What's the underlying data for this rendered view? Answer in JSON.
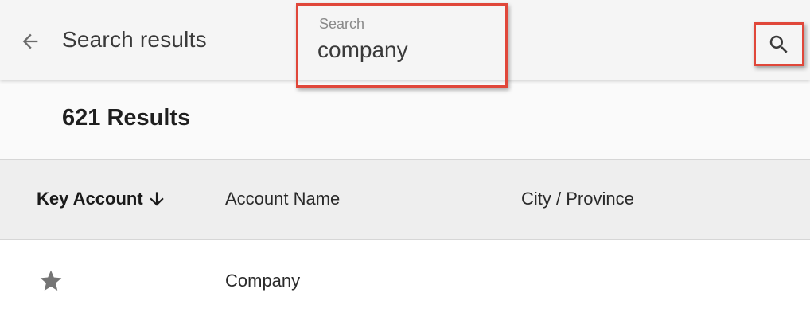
{
  "header": {
    "back_icon": "arrow-left-icon",
    "title": "Search results"
  },
  "search": {
    "label": "Search",
    "value": "company",
    "button_icon": "search-icon"
  },
  "results": {
    "count_label": "621 Results"
  },
  "table": {
    "columns": [
      {
        "label": "Key Account",
        "sorted": true,
        "sort_icon": "arrow-down-icon"
      },
      {
        "label": "Account Name"
      },
      {
        "label": "City / Province"
      }
    ],
    "rows": [
      {
        "key_account_icon": "star-icon",
        "account_name": "Company",
        "city_province": ""
      }
    ]
  },
  "colors": {
    "highlight": "#e0473a",
    "toolbar_bg": "#f5f5f5",
    "header_bg": "#eeeeee",
    "star": "#757575"
  }
}
